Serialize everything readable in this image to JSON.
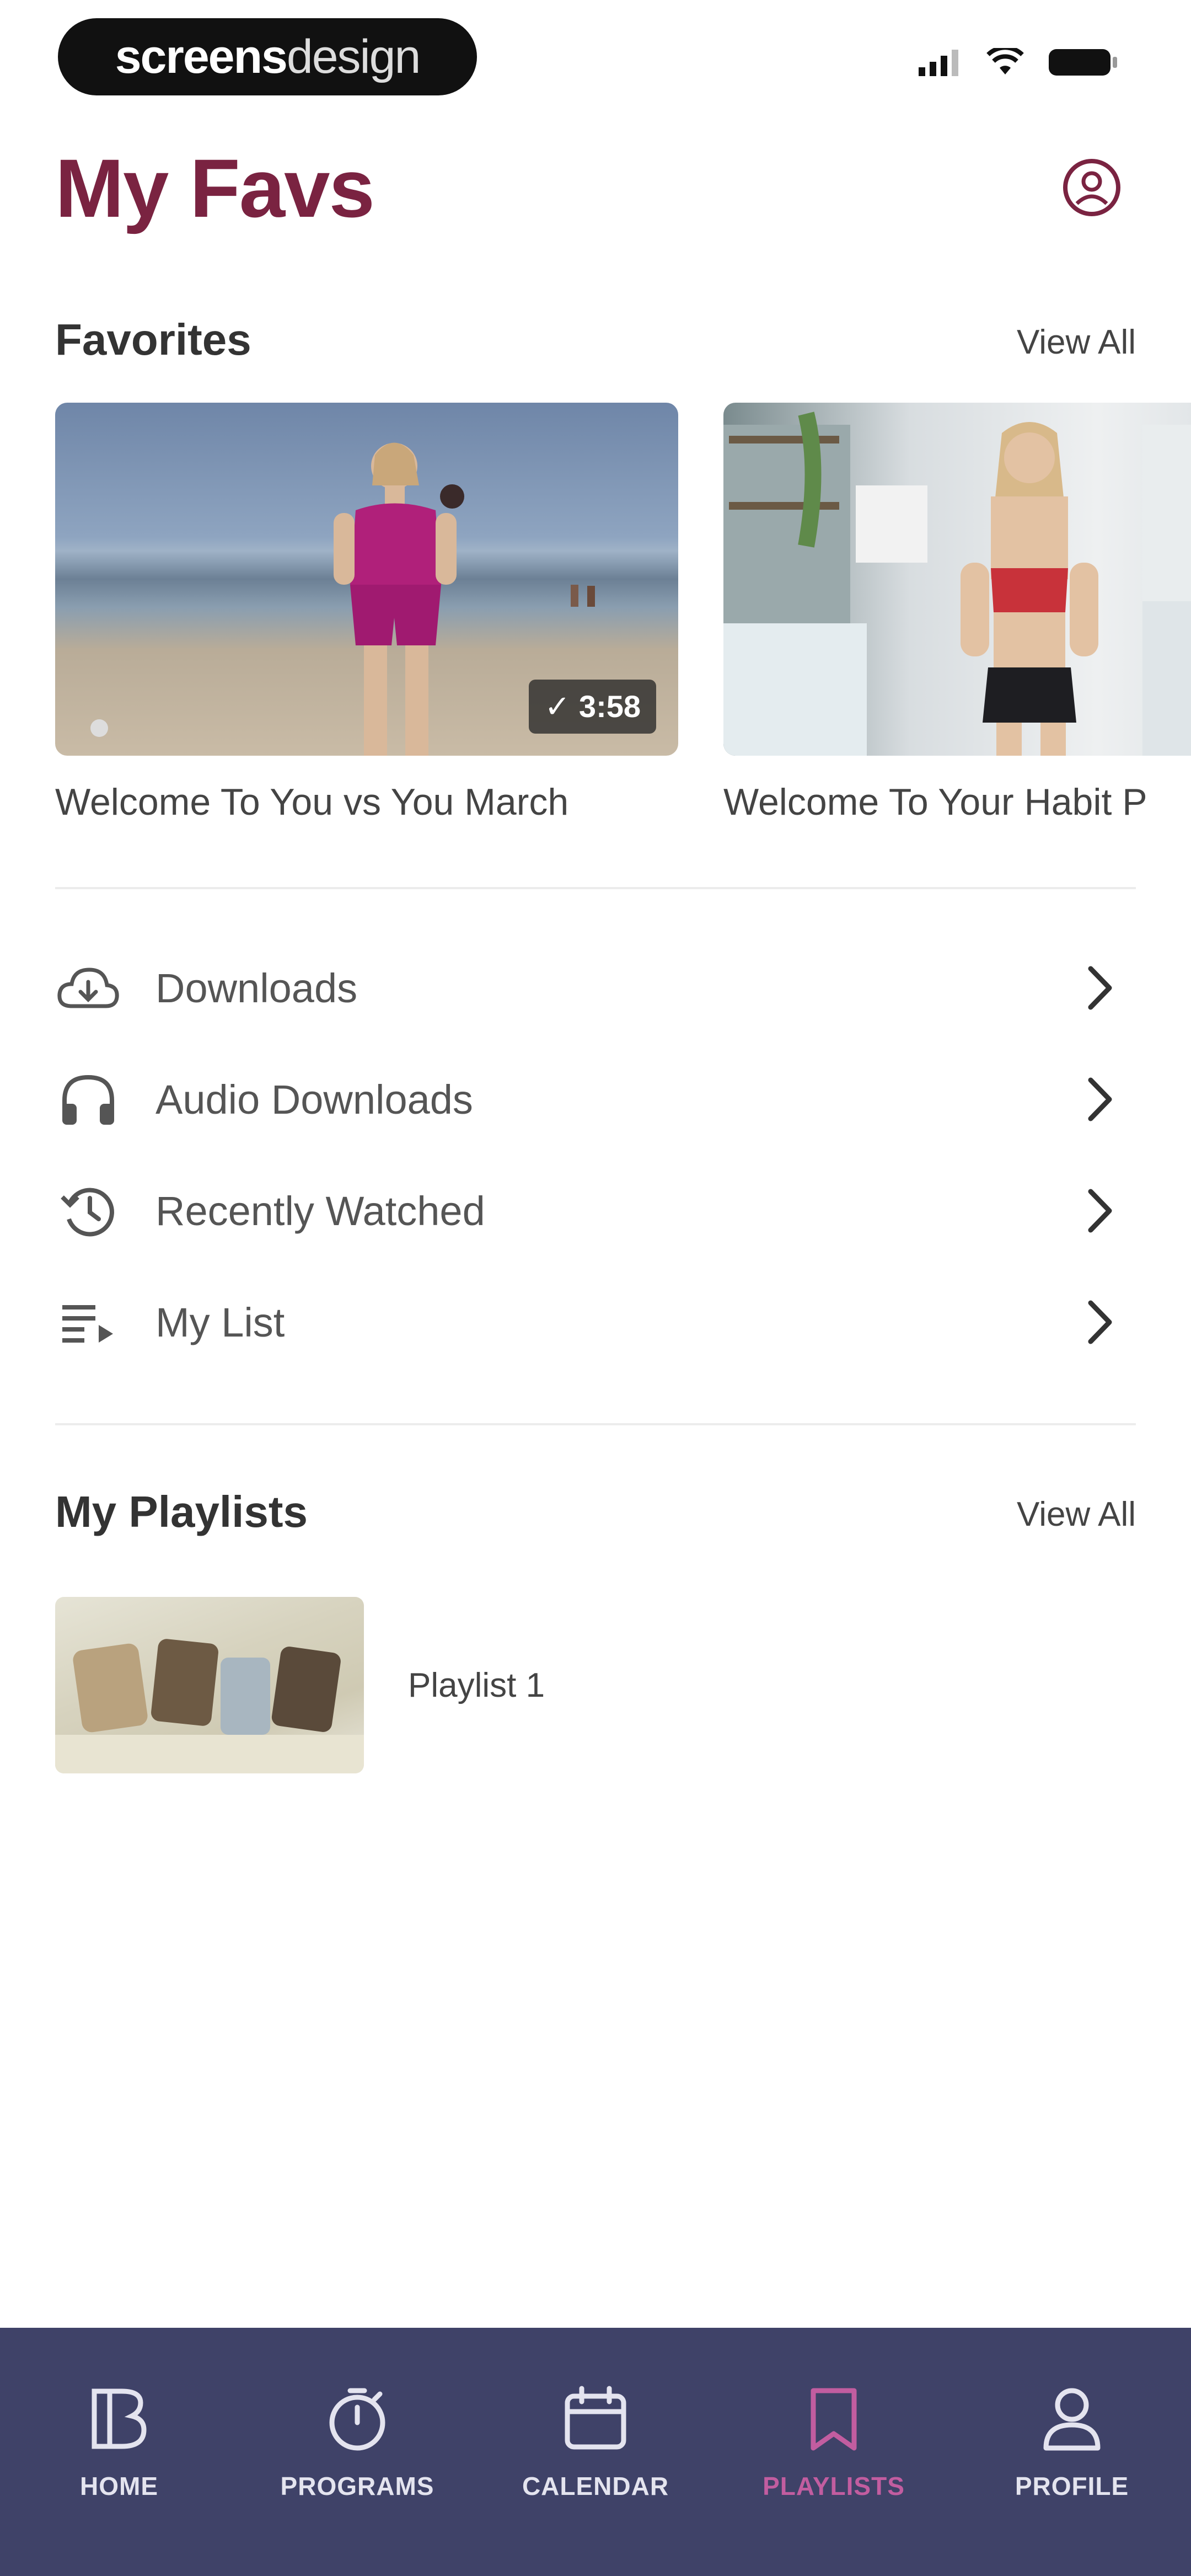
{
  "status_bar": {
    "brand_bold": "screens",
    "brand_light": "design"
  },
  "header": {
    "title": "My Favs",
    "profile_icon": "user-circle-icon"
  },
  "favorites": {
    "title": "Favorites",
    "view_all": "View All",
    "items": [
      {
        "title": "Welcome To You vs You March",
        "duration": "✓ 3:58"
      },
      {
        "title": "Welcome To Your Habit P"
      }
    ]
  },
  "menu": {
    "items": [
      {
        "label": "Downloads",
        "icon": "cloud-download-icon"
      },
      {
        "label": "Audio Downloads",
        "icon": "headphones-icon"
      },
      {
        "label": "Recently Watched",
        "icon": "history-icon"
      },
      {
        "label": "My List",
        "icon": "playlist-add-icon"
      }
    ]
  },
  "playlists": {
    "title": "My Playlists",
    "view_all": "View All",
    "items": [
      {
        "label": "Playlist 1"
      }
    ]
  },
  "bottom_nav": {
    "items": [
      {
        "label": "HOME",
        "icon": "brand-logo-icon"
      },
      {
        "label": "PROGRAMS",
        "icon": "stopwatch-icon"
      },
      {
        "label": "CALENDAR",
        "icon": "calendar-icon"
      },
      {
        "label": "PLAYLISTS",
        "icon": "bookmark-icon"
      },
      {
        "label": "PROFILE",
        "icon": "person-icon"
      }
    ],
    "active": "PLAYLISTS",
    "active_color": "#c25da0",
    "bg_color": "#3f4268"
  },
  "colors": {
    "title": "#7a2341"
  }
}
